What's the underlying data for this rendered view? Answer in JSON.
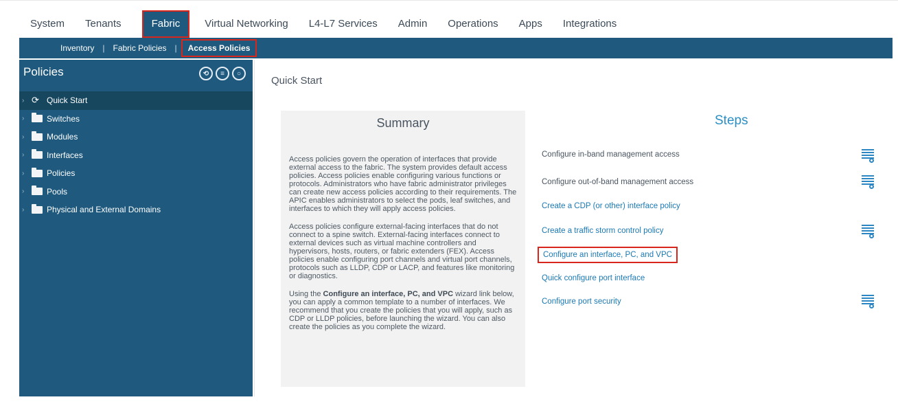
{
  "topnav": {
    "tabs": [
      "System",
      "Tenants",
      "Fabric",
      "Virtual Networking",
      "L4-L7 Services",
      "Admin",
      "Operations",
      "Apps",
      "Integrations"
    ],
    "active": "Fabric"
  },
  "subnav": {
    "items": [
      "Inventory",
      "Fabric Policies",
      "Access Policies"
    ],
    "separator": "|",
    "active": "Access Policies"
  },
  "sidebar": {
    "title": "Policies",
    "icons": [
      "view-mode-icon",
      "list-view-icon",
      "refresh-icon"
    ],
    "items": [
      {
        "label": "Quick Start",
        "icon": "quick-start-icon"
      },
      {
        "label": "Switches",
        "icon": "folder-icon"
      },
      {
        "label": "Modules",
        "icon": "folder-icon"
      },
      {
        "label": "Interfaces",
        "icon": "folder-icon"
      },
      {
        "label": "Policies",
        "icon": "folder-icon"
      },
      {
        "label": "Pools",
        "icon": "folder-icon"
      },
      {
        "label": "Physical and External Domains",
        "icon": "folder-icon"
      }
    ]
  },
  "main": {
    "title": "Quick Start",
    "summary": {
      "title": "Summary",
      "para1": "Access policies govern the operation of interfaces that provide external access to the fabric. The system provides default access policies. Access policies enable configuring various functions or protocols. Administrators who have fabric administrator privileges can create new access policies according to their requirements. The APIC enables administrators to select the pods, leaf switches, and interfaces to which they will apply access policies.",
      "para2": "Access policies configure external-facing interfaces that do not connect to a spine switch. External-facing interfaces connect to external devices such as virtual machine controllers and hypervisors, hosts, routers, or fabric extenders (FEX). Access policies enable configuring port channels and virtual port channels, protocols such as LLDP, CDP or LACP, and features like monitoring or diagnostics.",
      "para3_before": "Using the ",
      "para3_bold": "Configure an interface, PC, and VPC",
      "para3_after": " wizard link below, you can apply a common template to a number of interfaces. We recommend that you create the policies that you will apply, such as CDP or LLDP policies, before launching the wizard. You can also create the policies as you complete the wizard."
    },
    "steps": {
      "title": "Steps",
      "items": [
        {
          "label": "Configure in-band management access",
          "style": "plain",
          "has_icon": true
        },
        {
          "label": "Configure out-of-band management access",
          "style": "plain",
          "has_icon": true
        },
        {
          "label": "Create a CDP (or other) interface policy",
          "style": "link",
          "has_icon": false
        },
        {
          "label": "Create a traffic storm control policy",
          "style": "link",
          "has_icon": true
        },
        {
          "label": "Configure an interface, PC, and VPC",
          "style": "link",
          "has_icon": false,
          "highlighted": true
        },
        {
          "label": "Quick configure port interface",
          "style": "link",
          "has_icon": false
        },
        {
          "label": "Configure port security",
          "style": "link",
          "has_icon": true
        }
      ]
    }
  },
  "colors": {
    "nav_blue": "#1f5a7e",
    "highlight_red": "#d9261c",
    "link_blue": "#1a79b4",
    "steps_title_blue": "#2b8fc6"
  }
}
